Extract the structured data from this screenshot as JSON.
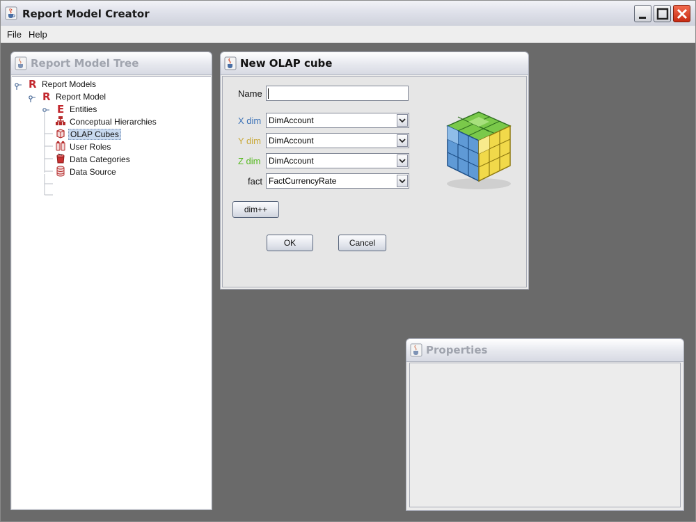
{
  "window": {
    "title": "Report Model Creator"
  },
  "menu": {
    "file": "File",
    "help": "Help"
  },
  "tree_panel": {
    "title": "Report Model Tree",
    "nodes": {
      "root": "Report Models",
      "model": "Report Model",
      "entities": "Entities",
      "hierarchies": "Conceptual Hierarchies",
      "olap": "OLAP Cubes",
      "roles": "User Roles",
      "categories": "Data Categories",
      "source": "Data Source"
    },
    "selected": "OLAP Cubes"
  },
  "cube_dialog": {
    "title": "New OLAP cube",
    "name_label": "Name",
    "name_value": "",
    "x_label": "X dim",
    "y_label": "Y dim",
    "z_label": "Z dim",
    "fact_label": "fact",
    "x_value": "DimAccount",
    "y_value": "DimAccount",
    "z_value": "DimAccount",
    "fact_value": "FactCurrencyRate",
    "add_dim_label": "dim++",
    "ok_label": "OK",
    "cancel_label": "Cancel",
    "colors": {
      "x": "#3f74b7",
      "y": "#c9a93a",
      "z": "#55b81e"
    }
  },
  "properties_panel": {
    "title": "Properties"
  },
  "icons": {
    "app": "java-cup-icon",
    "model": "report-model-icon",
    "entity": "entity-icon",
    "hierarchy": "hierarchy-icon",
    "cube": "olap-cube-icon",
    "roles": "user-roles-icon",
    "categories": "data-categories-icon",
    "source": "database-icon"
  }
}
